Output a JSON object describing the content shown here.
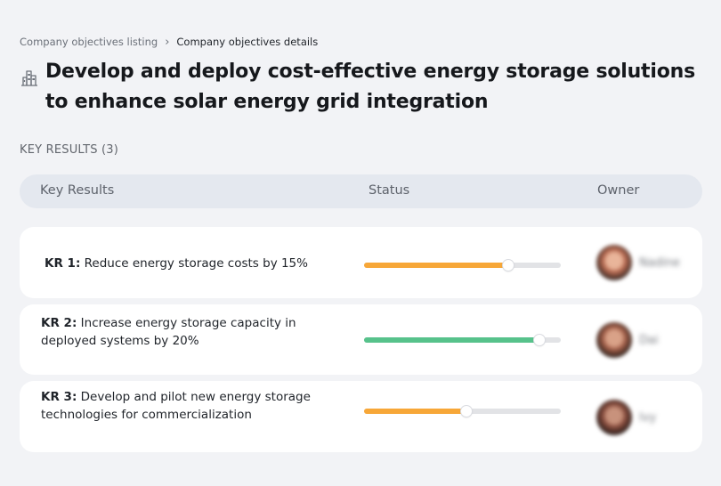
{
  "breadcrumb": {
    "parent": "Company objectives listing",
    "separator": "›",
    "current": "Company objectives details"
  },
  "page": {
    "icon": "building-chart-icon",
    "title": "Develop and deploy cost-effective energy storage solutions to enhance solar energy grid integration"
  },
  "key_results_section": {
    "label": "KEY RESULTS (3)"
  },
  "table": {
    "columns": [
      "Key Results",
      "Status",
      "Owner"
    ],
    "rows": [
      {
        "id": "KR 1:",
        "text": "Reduce energy storage costs by 15%",
        "progress": 0.735,
        "status_color": "#f7a738",
        "owner": {
          "name": "Nadine",
          "avatar_colors": [
            "#3a2a25",
            "#b96b52",
            "#e9b59a"
          ]
        }
      },
      {
        "id": "KR 2:",
        "text": "Increase energy storage capacity in deployed systems by 20%",
        "progress": 0.89,
        "status_color": "#57c28b",
        "owner": {
          "name": "Dai",
          "avatar_colors": [
            "#2f221d",
            "#a4604a",
            "#d9a288"
          ]
        }
      },
      {
        "id": "KR 3:",
        "text": "Develop and pilot new energy storage technologies for commercialization",
        "progress": 0.52,
        "status_color": "#f7a738",
        "owner": {
          "name": "Ivy",
          "avatar_colors": [
            "#2a1d1a",
            "#8a4e3f",
            "#c8927c"
          ]
        }
      }
    ]
  }
}
